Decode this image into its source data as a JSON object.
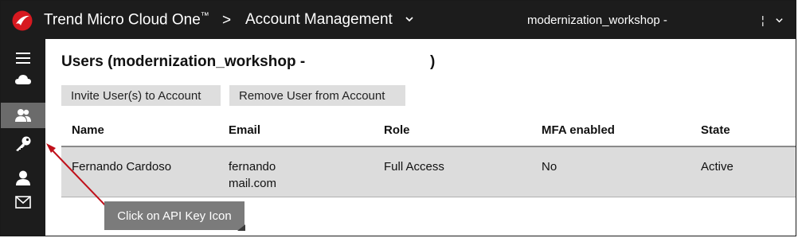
{
  "topbar": {
    "brand": "Trend Micro Cloud One",
    "trademark": "™",
    "separator": ">",
    "section": "Account Management",
    "account_name": "modernization_workshop -",
    "right_control": "¦",
    "brand_color": "#d71920"
  },
  "sidebar": {
    "items": [
      {
        "icon": "menu-icon"
      },
      {
        "icon": "cloud-icon"
      },
      {
        "icon": "users-icon",
        "active": true
      },
      {
        "icon": "key-icon"
      },
      {
        "icon": "user-icon"
      },
      {
        "icon": "mail-icon"
      }
    ]
  },
  "main": {
    "title": "Users (modernization_workshop -",
    "title_end": ")",
    "invite_label": "Invite User(s) to Account",
    "remove_label": "Remove User from Account"
  },
  "table": {
    "headers": {
      "name": "Name",
      "email": "Email",
      "role": "Role",
      "mfa": "MFA enabled",
      "state": "State"
    },
    "rows": [
      {
        "name": "Fernando Cardoso",
        "email_line1": "fernando",
        "email_line2": "mail.com",
        "role": "Full Access",
        "mfa": "No",
        "state": "Active"
      }
    ]
  },
  "annotation": {
    "text": "Click on API Key Icon",
    "arrow_color": "#c0101a"
  }
}
